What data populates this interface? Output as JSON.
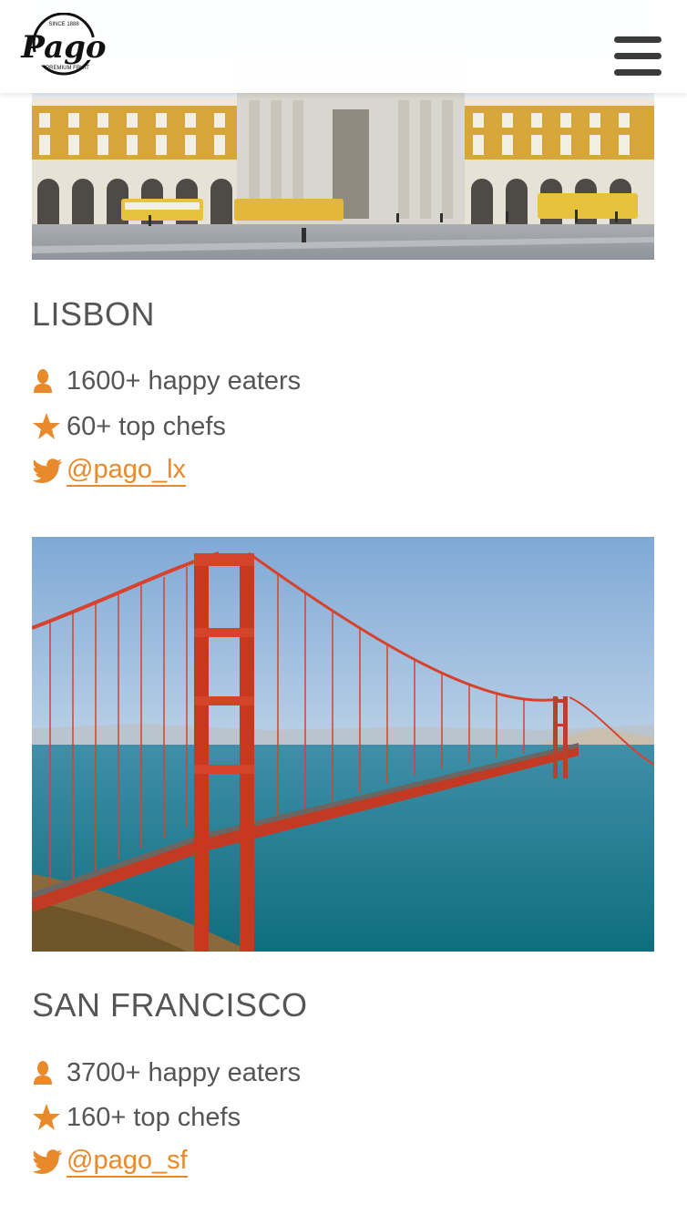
{
  "brand": {
    "logo_text": "Pago",
    "logo_ring_top": "SINCE 1888",
    "logo_ring_bottom": "PREMIUM FRUIT",
    "accent_color": "#e8892b"
  },
  "header": {
    "menu_icon": "hamburger-menu-icon"
  },
  "cities": [
    {
      "name": "LISBON",
      "photo": "lisbon-praca-do-comercio-photo",
      "stats": [
        {
          "icon": "user-icon",
          "text": "1600+ happy eaters"
        },
        {
          "icon": "star-icon",
          "text": "60+ top chefs"
        }
      ],
      "twitter": {
        "icon": "twitter-bird-icon",
        "handle": "@pago_lx"
      }
    },
    {
      "name": "SAN FRANCISCO",
      "photo": "golden-gate-bridge-photo",
      "stats": [
        {
          "icon": "user-icon",
          "text": "3700+ happy eaters"
        },
        {
          "icon": "star-icon",
          "text": "160+ top chefs"
        }
      ],
      "twitter": {
        "icon": "twitter-bird-icon",
        "handle": "@pago_sf"
      }
    }
  ]
}
